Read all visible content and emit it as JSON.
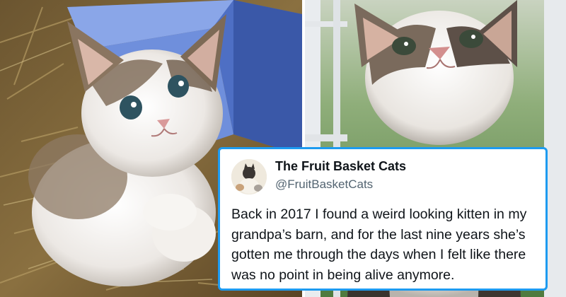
{
  "photos": {
    "left": {
      "subject": "kitten-in-straw"
    },
    "right": {
      "subject": "cat-by-window"
    }
  },
  "tweet": {
    "account_name": "The Fruit Basket Cats",
    "handle": "@FruitBasketCats",
    "text": "Back in 2017 I found a weird looking kitten in my grandpa’s barn, and for the last nine years she’s gotten me through the days when I felt like there was no point in being alive anymore."
  },
  "colors": {
    "card_border": "#1d9bf0",
    "name_text": "#0f1419",
    "handle_text": "#536471"
  }
}
